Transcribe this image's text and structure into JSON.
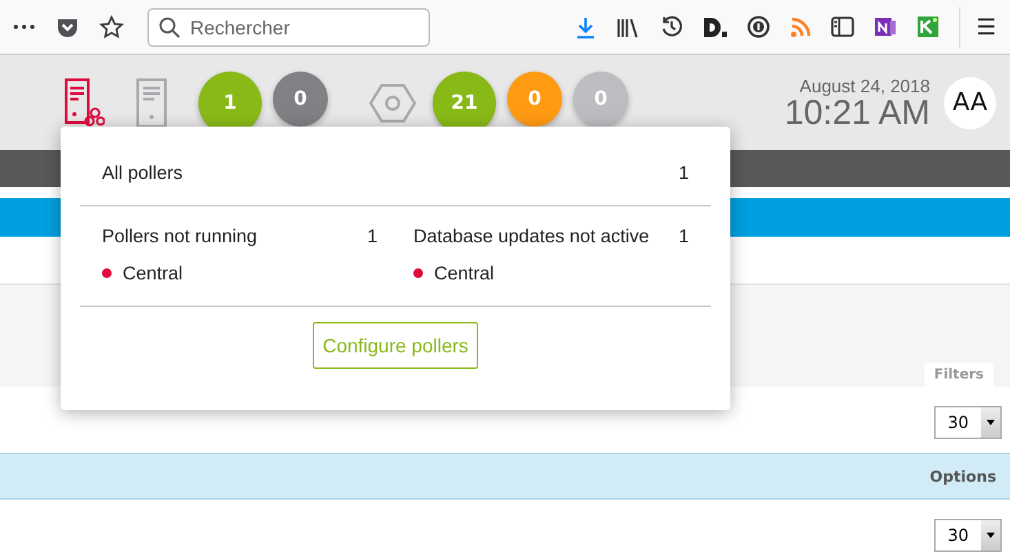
{
  "browser": {
    "search": {
      "placeholder": "Rechercher"
    },
    "menu_glyph": "☰"
  },
  "header": {
    "counters_pollers": [
      {
        "value": "1",
        "color": "#88b917"
      },
      {
        "value": "0",
        "color": "#818185"
      }
    ],
    "counters_services": [
      {
        "value": "21",
        "color": "#88b917"
      },
      {
        "value": "0",
        "color": "#ff9a13"
      },
      {
        "value": "0",
        "color": "#bcbdc0"
      }
    ],
    "date": "August 24, 2018",
    "time": "10:21 AM",
    "avatar": "AA"
  },
  "popup": {
    "all_label": "All pollers",
    "all_count": "1",
    "columns": [
      {
        "label": "Pollers not running",
        "count": "1",
        "items": [
          {
            "name": "Central",
            "color": "#e00b3d"
          }
        ]
      },
      {
        "label": "Database updates not active",
        "count": "1",
        "items": [
          {
            "name": "Central",
            "color": "#e00b3d"
          }
        ]
      }
    ],
    "button": "Configure pollers"
  },
  "page": {
    "filters_tab": "Filters",
    "options_header": "Options",
    "selects": [
      "30",
      "30"
    ]
  }
}
